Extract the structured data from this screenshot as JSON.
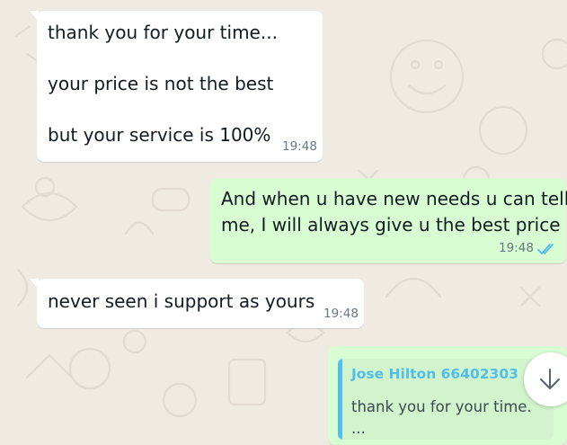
{
  "messages": [
    {
      "direction": "incoming",
      "lines": [
        "thank you for your time...",
        "your price is not the best",
        "but your service is 100%"
      ],
      "time": "19:48"
    },
    {
      "direction": "outgoing",
      "lines": [
        "And when u have new needs u can tell",
        "me, I will always give u the best price"
      ],
      "time": "19:48",
      "status": "read"
    },
    {
      "direction": "incoming",
      "lines": [
        "never seen i support as yours"
      ],
      "time": "19:48"
    },
    {
      "direction": "outgoing",
      "quote": {
        "author": "Jose Hilton 66402303",
        "text_lines": [
          "thank you for your time.",
          "..."
        ]
      }
    }
  ],
  "icons": {
    "read_receipt": "double-check-icon",
    "scroll_down": "arrow-down-icon"
  },
  "colors": {
    "background": "#efeae2",
    "incoming_bubble": "#ffffff",
    "outgoing_bubble": "#d9fdd3",
    "read_tick": "#53bdeb",
    "quote_accent": "#53bdeb"
  }
}
